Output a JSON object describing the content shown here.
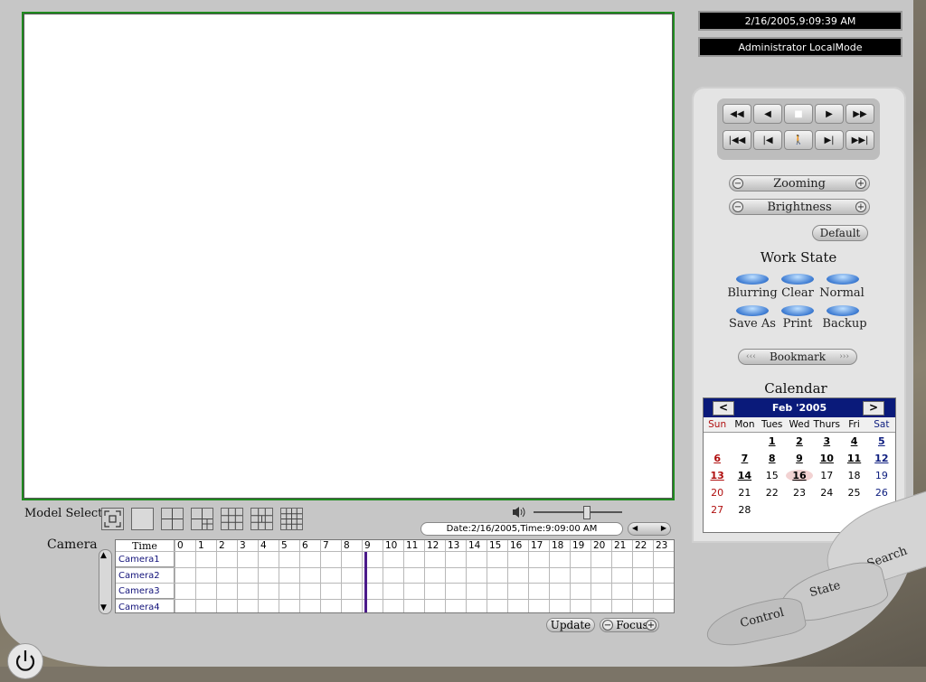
{
  "status": {
    "datetime": "2/16/2005,9:09:39 AM",
    "user_mode": "Administrator  LocalMode"
  },
  "transport": {
    "row1": [
      "◀◀",
      "◀",
      "■",
      "▶",
      "▶▶"
    ],
    "row2": [
      "|◀◀",
      "|◀",
      "🚶",
      "▶|",
      "▶▶|"
    ]
  },
  "zooming": {
    "label": "Zooming",
    "minus": "−",
    "plus": "+"
  },
  "brightness": {
    "label": "Brightness",
    "minus": "−",
    "plus": "+"
  },
  "default_label": "Default",
  "work_state": {
    "title": "Work State",
    "items": [
      "Blurring",
      "Clear",
      "Normal",
      "Save As",
      "Print",
      "Backup"
    ]
  },
  "bookmark": {
    "label": "Bookmark",
    "left": "‹‹‹",
    "right": "›››"
  },
  "calendar": {
    "title": "Calendar",
    "month": "Feb '2005",
    "prev": "<",
    "next": ">",
    "dow": [
      "Sun",
      "Mon",
      "Tues",
      "Wed",
      "Thurs",
      "Fri",
      "Sat"
    ],
    "weeks": [
      [
        "",
        "",
        "1",
        "2",
        "3",
        "4",
        "5"
      ],
      [
        "6",
        "7",
        "8",
        "9",
        "10",
        "11",
        "12"
      ],
      [
        "13",
        "14",
        "15",
        "16",
        "17",
        "18",
        "19"
      ],
      [
        "20",
        "21",
        "22",
        "23",
        "24",
        "25",
        "26"
      ],
      [
        "27",
        "28",
        "",
        "",
        "",
        "",
        ""
      ]
    ],
    "recorded_days": [
      "1",
      "2",
      "3",
      "4",
      "5",
      "6",
      "7",
      "8",
      "9",
      "10",
      "11",
      "12",
      "13",
      "14",
      "16"
    ],
    "today": "16"
  },
  "model_select": {
    "label": "Model Select"
  },
  "volume": {
    "level": 0.6
  },
  "playback_time": "Date:2/16/2005,Time:9:09:00 AM",
  "camera_section": {
    "label": "Camera",
    "time_header": "Time"
  },
  "hours": [
    "0",
    "1",
    "2",
    "3",
    "4",
    "5",
    "6",
    "7",
    "8",
    "9",
    "10",
    "11",
    "12",
    "13",
    "14",
    "15",
    "16",
    "17",
    "18",
    "19",
    "20",
    "21",
    "22",
    "23"
  ],
  "cameras": [
    "Camera1",
    "Camera2",
    "Camera3",
    "Camera4"
  ],
  "cursor_hour": 9.1,
  "update_label": "Update",
  "focus": {
    "label": "Focus",
    "minus": "−",
    "plus": "+"
  },
  "tabs": [
    "Search",
    "State",
    "Control"
  ],
  "colors": {
    "calendar_header": "#0a1a7a",
    "video_border": "#1f8a1f",
    "timeline_cursor": "#4b1a8a"
  }
}
